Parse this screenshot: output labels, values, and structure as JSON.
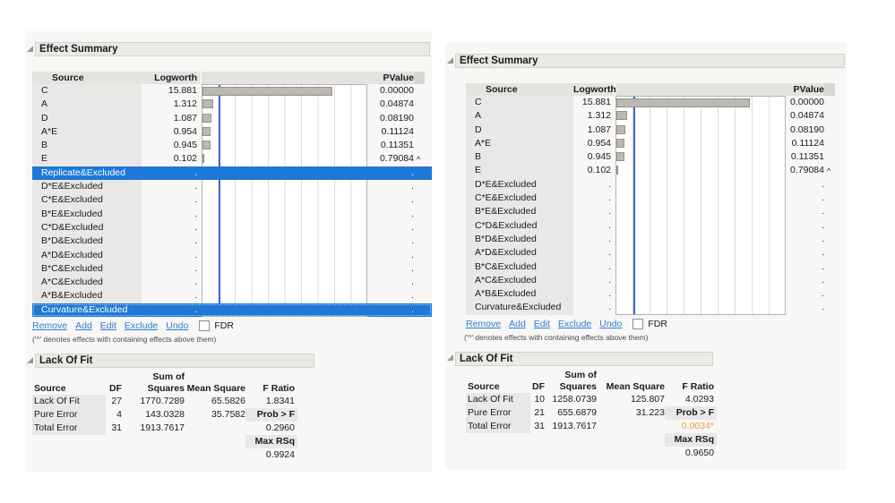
{
  "colors": {
    "selection_blue": "#1E79D6",
    "link_blue": "#2F7BD3",
    "ref_line_blue": "#3A64D8",
    "bar_fill": "#BCB9B0",
    "significant_orange": "#EE9B3F"
  },
  "panels": [
    {
      "effect_summary": {
        "title": "Effect Summary",
        "columns": {
          "source": "Source",
          "logworth": "Logworth",
          "pvalue": "PValue"
        },
        "axis": {
          "min": 0,
          "max": 20,
          "ref_line": 2
        },
        "rows": [
          {
            "source": "C",
            "logworth": "15.881",
            "logworth_value": 15.881,
            "pvalue": "0.00000"
          },
          {
            "source": "A",
            "logworth": "1.312",
            "logworth_value": 1.312,
            "pvalue": "0.04874"
          },
          {
            "source": "D",
            "logworth": "1.087",
            "logworth_value": 1.087,
            "pvalue": "0.08190"
          },
          {
            "source": "A*E",
            "logworth": "0.954",
            "logworth_value": 0.954,
            "pvalue": "0.11124"
          },
          {
            "source": "B",
            "logworth": "0.945",
            "logworth_value": 0.945,
            "pvalue": "0.11351"
          },
          {
            "source": "E",
            "logworth": "0.102",
            "logworth_value": 0.102,
            "pvalue": "0.79084",
            "caret": "^"
          },
          {
            "source": "Replicate&Excluded",
            "logworth": ".",
            "logworth_value": 0,
            "pvalue": ".",
            "selected": true
          },
          {
            "source": "D*E&Excluded",
            "logworth": ".",
            "logworth_value": 0,
            "pvalue": "."
          },
          {
            "source": "C*E&Excluded",
            "logworth": ".",
            "logworth_value": 0,
            "pvalue": "."
          },
          {
            "source": "B*E&Excluded",
            "logworth": ".",
            "logworth_value": 0,
            "pvalue": "."
          },
          {
            "source": "C*D&Excluded",
            "logworth": ".",
            "logworth_value": 0,
            "pvalue": "."
          },
          {
            "source": "B*D&Excluded",
            "logworth": ".",
            "logworth_value": 0,
            "pvalue": "."
          },
          {
            "source": "A*D&Excluded",
            "logworth": ".",
            "logworth_value": 0,
            "pvalue": "."
          },
          {
            "source": "B*C&Excluded",
            "logworth": ".",
            "logworth_value": 0,
            "pvalue": "."
          },
          {
            "source": "A*C&Excluded",
            "logworth": ".",
            "logworth_value": 0,
            "pvalue": "."
          },
          {
            "source": "A*B&Excluded",
            "logworth": ".",
            "logworth_value": 0,
            "pvalue": "."
          },
          {
            "source": "Curvature&Excluded",
            "logworth": ".",
            "logworth_value": 0,
            "pvalue": ".",
            "selected": true,
            "focus": true
          }
        ],
        "actions": [
          "Remove",
          "Add",
          "Edit",
          "Exclude",
          "Undo"
        ],
        "fdr_label": "FDR",
        "note": "('^' denotes effects with containing effects above them)"
      },
      "lack_of_fit": {
        "title": "Lack Of Fit",
        "col_headers": {
          "sum_of": "Sum of",
          "source": "Source",
          "df": "DF",
          "squares": "Squares",
          "mean_square": "Mean Square",
          "f_ratio": "F Ratio"
        },
        "rows": [
          {
            "source": "Lack Of Fit",
            "df": "27",
            "ss": "1770.7289",
            "ms": "65.5826",
            "f": "1.8341",
            "src_cell": true
          },
          {
            "source": "Pure Error",
            "df": "4",
            "ss": "143.0328",
            "ms": "35.7582",
            "f": "Prob > F",
            "src_cell": true,
            "f_label": true
          },
          {
            "source": "Total Error",
            "df": "31",
            "ss": "1913.7617",
            "ms": "",
            "f": "0.2960",
            "src_cell": true
          },
          {
            "source": "",
            "df": "",
            "ss": "",
            "ms": "",
            "f": "Max RSq",
            "f_label": true
          },
          {
            "source": "",
            "df": "",
            "ss": "",
            "ms": "",
            "f": "0.9924"
          }
        ]
      }
    },
    {
      "effect_summary": {
        "title": "Effect Summary",
        "columns": {
          "source": "Source",
          "logworth": "Logworth",
          "pvalue": "PValue"
        },
        "axis": {
          "min": 0,
          "max": 20,
          "ref_line": 2
        },
        "rows": [
          {
            "source": "C",
            "logworth": "15.881",
            "logworth_value": 15.881,
            "pvalue": "0.00000"
          },
          {
            "source": "A",
            "logworth": "1.312",
            "logworth_value": 1.312,
            "pvalue": "0.04874"
          },
          {
            "source": "D",
            "logworth": "1.087",
            "logworth_value": 1.087,
            "pvalue": "0.08190"
          },
          {
            "source": "A*E",
            "logworth": "0.954",
            "logworth_value": 0.954,
            "pvalue": "0.11124"
          },
          {
            "source": "B",
            "logworth": "0.945",
            "logworth_value": 0.945,
            "pvalue": "0.11351"
          },
          {
            "source": "E",
            "logworth": "0.102",
            "logworth_value": 0.102,
            "pvalue": "0.79084",
            "caret": "^"
          },
          {
            "source": "D*E&Excluded",
            "logworth": ".",
            "logworth_value": 0,
            "pvalue": "."
          },
          {
            "source": "C*E&Excluded",
            "logworth": ".",
            "logworth_value": 0,
            "pvalue": "."
          },
          {
            "source": "B*E&Excluded",
            "logworth": ".",
            "logworth_value": 0,
            "pvalue": "."
          },
          {
            "source": "C*D&Excluded",
            "logworth": ".",
            "logworth_value": 0,
            "pvalue": "."
          },
          {
            "source": "B*D&Excluded",
            "logworth": ".",
            "logworth_value": 0,
            "pvalue": "."
          },
          {
            "source": "A*D&Excluded",
            "logworth": ".",
            "logworth_value": 0,
            "pvalue": "."
          },
          {
            "source": "B*C&Excluded",
            "logworth": ".",
            "logworth_value": 0,
            "pvalue": "."
          },
          {
            "source": "A*C&Excluded",
            "logworth": ".",
            "logworth_value": 0,
            "pvalue": "."
          },
          {
            "source": "A*B&Excluded",
            "logworth": ".",
            "logworth_value": 0,
            "pvalue": "."
          },
          {
            "source": "Curvature&Excluded",
            "logworth": ".",
            "logworth_value": 0,
            "pvalue": "."
          }
        ],
        "actions": [
          "Remove",
          "Add",
          "Edit",
          "Exclude",
          "Undo"
        ],
        "fdr_label": "FDR",
        "note": "('^' denotes effects with containing effects above them)"
      },
      "lack_of_fit": {
        "title": "Lack Of Fit",
        "col_headers": {
          "sum_of": "Sum of",
          "source": "Source",
          "df": "DF",
          "squares": "Squares",
          "mean_square": "Mean Square",
          "f_ratio": "F Ratio"
        },
        "rows": [
          {
            "source": "Lack Of Fit",
            "df": "10",
            "ss": "1258.0739",
            "ms": "125.807",
            "f": "4.0293",
            "src_cell": true
          },
          {
            "source": "Pure Error",
            "df": "21",
            "ss": "655.6879",
            "ms": "31.223",
            "f": "Prob > F",
            "src_cell": true,
            "f_label": true
          },
          {
            "source": "Total Error",
            "df": "31",
            "ss": "1913.7617",
            "ms": "",
            "f": "0.0034*",
            "src_cell": true,
            "f_orange": true
          },
          {
            "source": "",
            "df": "",
            "ss": "",
            "ms": "",
            "f": "Max RSq",
            "f_label": true
          },
          {
            "source": "",
            "df": "",
            "ss": "",
            "ms": "",
            "f": "0.9650"
          }
        ]
      }
    }
  ]
}
